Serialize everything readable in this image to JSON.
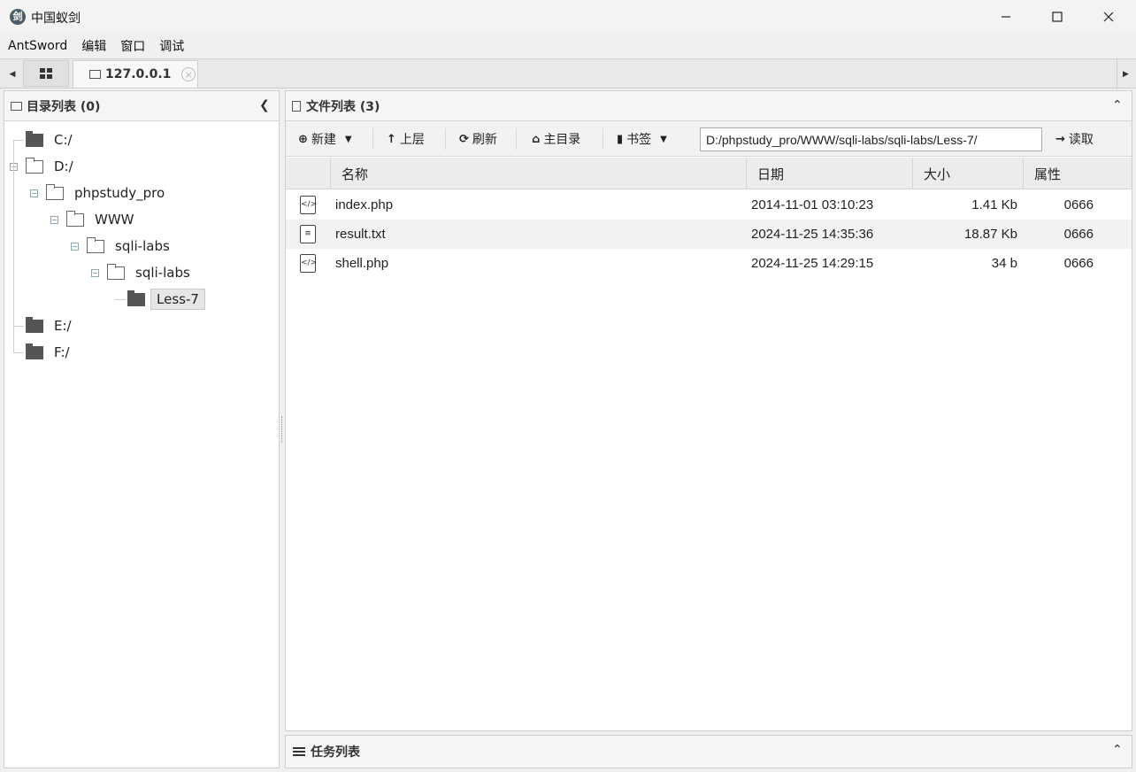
{
  "window": {
    "title": "中国蚁剑",
    "icon_glyph": "剑"
  },
  "menu": [
    "AntSword",
    "编辑",
    "窗口",
    "调试"
  ],
  "tabs": {
    "shell_tab_label": "127.0.0.1"
  },
  "left_panel": {
    "title": "目录列表 (0)",
    "tree": [
      {
        "label": "C:/",
        "level": 0,
        "state": "closed",
        "selected": false
      },
      {
        "label": "D:/",
        "level": 0,
        "state": "open",
        "selected": false
      },
      {
        "label": "phpstudy_pro",
        "level": 1,
        "state": "open",
        "selected": false
      },
      {
        "label": "WWW",
        "level": 2,
        "state": "open",
        "selected": false
      },
      {
        "label": "sqli-labs",
        "level": 3,
        "state": "open",
        "selected": false
      },
      {
        "label": "sqli-labs",
        "level": 4,
        "state": "open",
        "selected": false
      },
      {
        "label": "Less-7",
        "level": 5,
        "state": "closed",
        "selected": true
      },
      {
        "label": "E:/",
        "level": 0,
        "state": "closed",
        "selected": false
      },
      {
        "label": "F:/",
        "level": 0,
        "state": "closed",
        "selected": false
      }
    ]
  },
  "right_panel": {
    "title": "文件列表 (3)",
    "toolbar": {
      "new_label": "新建",
      "up_label": "上层",
      "refresh_label": "刷新",
      "home_label": "主目录",
      "bookmark_label": "书签",
      "path_value": "D:/phpstudy_pro/WWW/sqli-labs/sqli-labs/Less-7/",
      "read_label": "读取"
    },
    "columns": [
      "名称",
      "日期",
      "大小",
      "属性"
    ],
    "files": [
      {
        "name": "index.php",
        "date": "2014-11-01 03:10:23",
        "size": "1.41 Kb",
        "attr": "0666",
        "icon": "code-file-icon"
      },
      {
        "name": "result.txt",
        "date": "2024-11-25 14:35:36",
        "size": "18.87 Kb",
        "attr": "0666",
        "icon": "text-file-icon"
      },
      {
        "name": "shell.php",
        "date": "2024-11-25 14:29:15",
        "size": "34 b",
        "attr": "0666",
        "icon": "code-file-icon"
      }
    ]
  },
  "task_panel": {
    "title": "任务列表"
  }
}
